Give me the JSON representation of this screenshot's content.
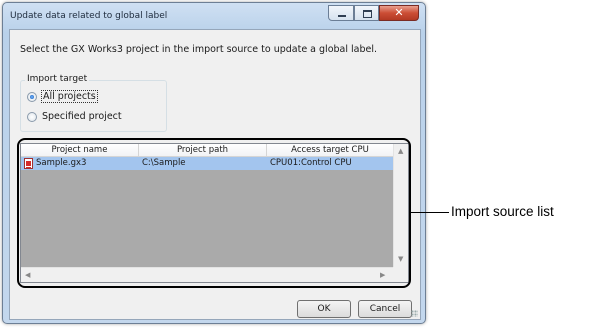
{
  "dialog": {
    "title": "Update data related to global label",
    "instruction": "Select the GX Works3 project in the import source to update a global label.",
    "import_target": {
      "legend": "Import target",
      "options": [
        {
          "label": "All projects",
          "checked": true
        },
        {
          "label": "Specified project",
          "checked": false
        }
      ]
    },
    "list": {
      "columns": [
        "Project name",
        "Project path",
        "Access target CPU"
      ],
      "rows": [
        {
          "name": "Sample.gx3",
          "path": "C:\\Sample",
          "cpu": "CPU01:Control CPU",
          "icon": "project-file-icon",
          "selected": true
        }
      ]
    },
    "buttons": {
      "ok": "OK",
      "cancel": "Cancel"
    }
  },
  "callout": {
    "label": "Import source list"
  },
  "colors": {
    "selection": "#a3c5ee",
    "list_background": "#aaaaaa",
    "close_button": "#cc4d35"
  }
}
